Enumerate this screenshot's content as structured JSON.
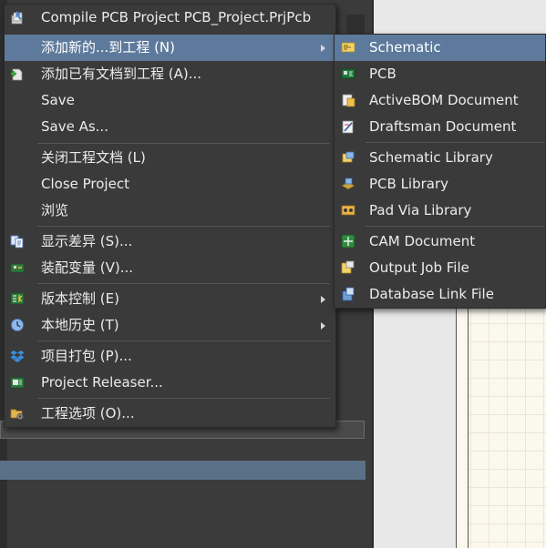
{
  "main_menu": {
    "items": [
      {
        "label": "Compile PCB Project PCB_Project.PrjPcb",
        "icon": "compile-icon"
      },
      {
        "label": "添加新的...到工程 (N)",
        "icon": "none",
        "has_submenu": true,
        "highlighted": true
      },
      {
        "label": "添加已有文档到工程 (A)...",
        "icon": "add-existing-icon"
      },
      {
        "label": "Save",
        "icon": "none"
      },
      {
        "label": "Save As...",
        "icon": "none"
      },
      {
        "label": "关闭工程文档 (L)",
        "icon": "none"
      },
      {
        "label": "Close Project",
        "icon": "none"
      },
      {
        "label": "浏览",
        "icon": "none"
      },
      {
        "label": "显示差异 (S)...",
        "icon": "show-differences-icon"
      },
      {
        "label": "装配变量 (V)...",
        "icon": "assembly-variants-icon"
      },
      {
        "label": "版本控制 (E)",
        "icon": "version-control-icon",
        "has_submenu": true
      },
      {
        "label": "本地历史 (T)",
        "icon": "local-history-icon",
        "has_submenu": true
      },
      {
        "label": "项目打包 (P)...",
        "icon": "project-packager-icon"
      },
      {
        "label": "Project Releaser...",
        "icon": "project-releaser-icon"
      },
      {
        "label": "工程选项 (O)...",
        "icon": "project-options-icon"
      }
    ]
  },
  "sub_menu": {
    "items": [
      {
        "label": "Schematic",
        "icon": "schematic-icon",
        "highlighted": true
      },
      {
        "label": "PCB",
        "icon": "pcb-icon"
      },
      {
        "label": "ActiveBOM Document",
        "icon": "activebom-icon"
      },
      {
        "label": "Draftsman Document",
        "icon": "draftsman-icon"
      },
      {
        "label": "Schematic Library",
        "icon": "schematic-library-icon"
      },
      {
        "label": "PCB Library",
        "icon": "pcb-library-icon"
      },
      {
        "label": "Pad Via Library",
        "icon": "pad-via-library-icon"
      },
      {
        "label": "CAM Document",
        "icon": "cam-document-icon"
      },
      {
        "label": "Output Job File",
        "icon": "output-job-icon"
      },
      {
        "label": "Database Link File",
        "icon": "database-link-icon"
      }
    ]
  },
  "colors": {
    "menu_bg": "#3a3a3a",
    "highlight": "#5d7a9c",
    "text": "#ececec",
    "separator": "#555555"
  }
}
